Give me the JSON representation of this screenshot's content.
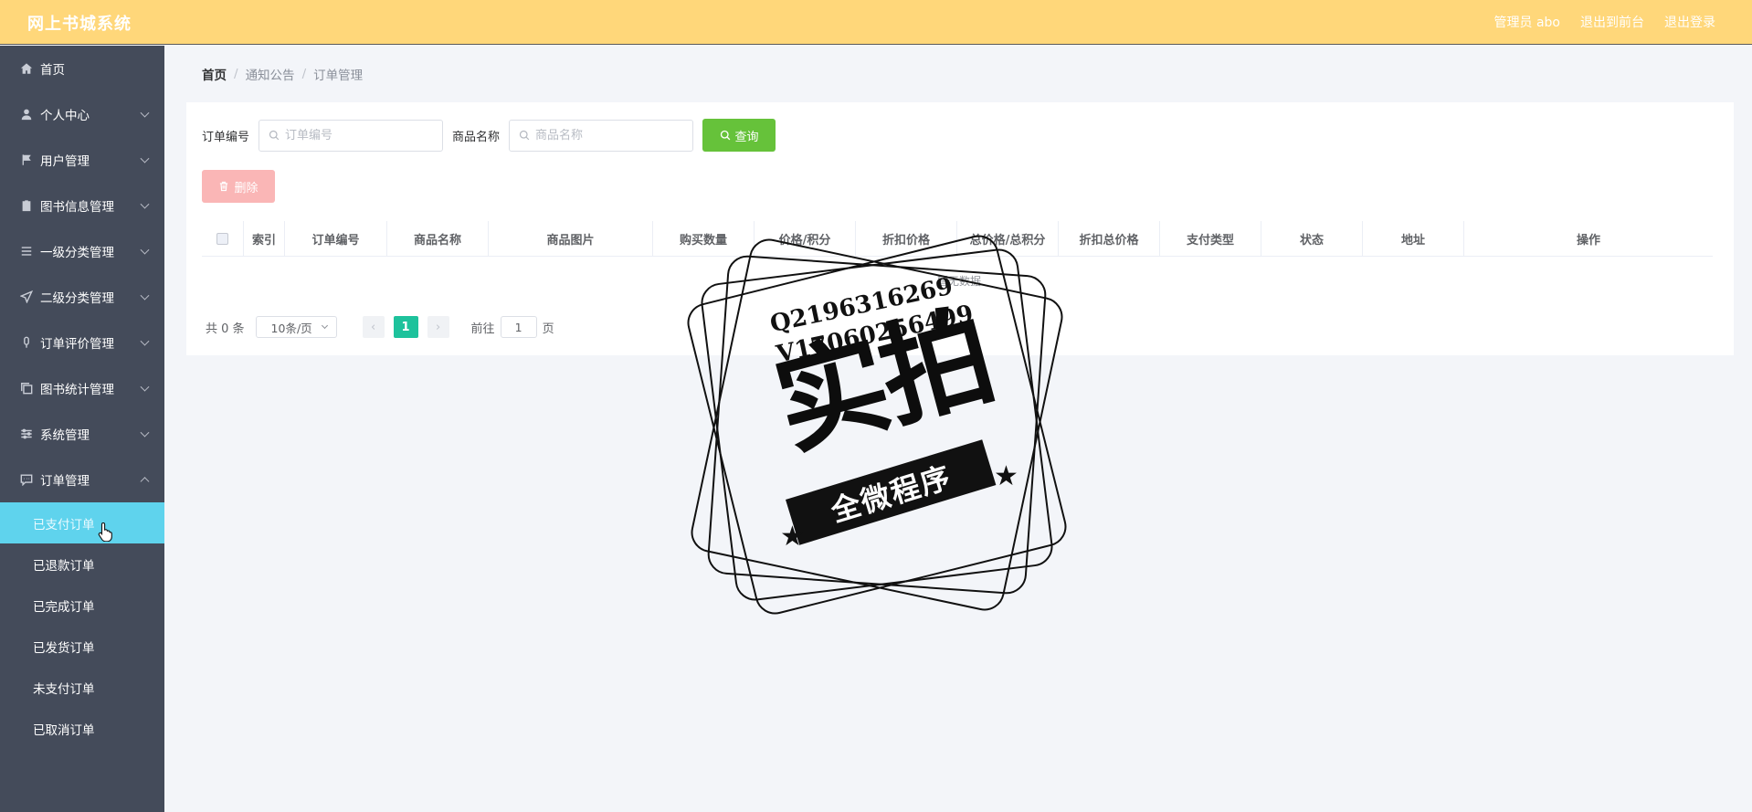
{
  "header": {
    "brand": "网上书城系统",
    "admin": "管理员 abo",
    "back_front": "退出到前台",
    "logout": "退出登录"
  },
  "sidebar": {
    "items": [
      {
        "label": "首页",
        "icon": "home-icon",
        "has_children": false
      },
      {
        "label": "个人中心",
        "icon": "user-icon",
        "has_children": true
      },
      {
        "label": "用户管理",
        "icon": "flag-icon",
        "has_children": true
      },
      {
        "label": "图书信息管理",
        "icon": "clipboard-icon",
        "has_children": true
      },
      {
        "label": "一级分类管理",
        "icon": "list-icon",
        "has_children": true
      },
      {
        "label": "二级分类管理",
        "icon": "send-icon",
        "has_children": true
      },
      {
        "label": "订单评价管理",
        "icon": "mic-icon",
        "has_children": true
      },
      {
        "label": "图书统计管理",
        "icon": "copy-icon",
        "has_children": true
      },
      {
        "label": "系统管理",
        "icon": "sliders-icon",
        "has_children": true
      },
      {
        "label": "订单管理",
        "icon": "chat-icon",
        "has_children": true,
        "expanded": true
      }
    ],
    "sub_items": [
      "已支付订单",
      "已退款订单",
      "已完成订单",
      "已发货订单",
      "未支付订单",
      "已取消订单"
    ],
    "active_sub": "已支付订单"
  },
  "breadcrumb": [
    "首页",
    "通知公告",
    "订单管理"
  ],
  "search": {
    "order_label": "订单编号",
    "order_placeholder": "订单编号",
    "product_label": "商品名称",
    "product_placeholder": "商品名称",
    "query_label": "查询"
  },
  "delete_label": "删除",
  "table": {
    "columns": [
      "索引",
      "订单编号",
      "商品名称",
      "商品图片",
      "购买数量",
      "价格/积分",
      "折扣价格",
      "总价格/总积分",
      "折扣总价格",
      "支付类型",
      "状态",
      "地址",
      "操作"
    ],
    "empty_text": "暂无数据"
  },
  "pager": {
    "total": "共 0 条",
    "page_size": "10条/页",
    "current_page": "1",
    "goto_prefix": "前往",
    "goto_value": "1",
    "goto_suffix": "页"
  },
  "watermark": {
    "line1": "Q2196316269",
    "line2": "V17060256499",
    "big": "实拍",
    "ribbon": "全微程序"
  },
  "colors": {
    "header_bg": "#ffd77a",
    "sidebar_bg": "#444b5a",
    "active_sub_bg": "#5fd3ed",
    "query_btn": "#66c23a",
    "delete_btn": "#fab6b6",
    "page_active": "#1ec29c"
  }
}
